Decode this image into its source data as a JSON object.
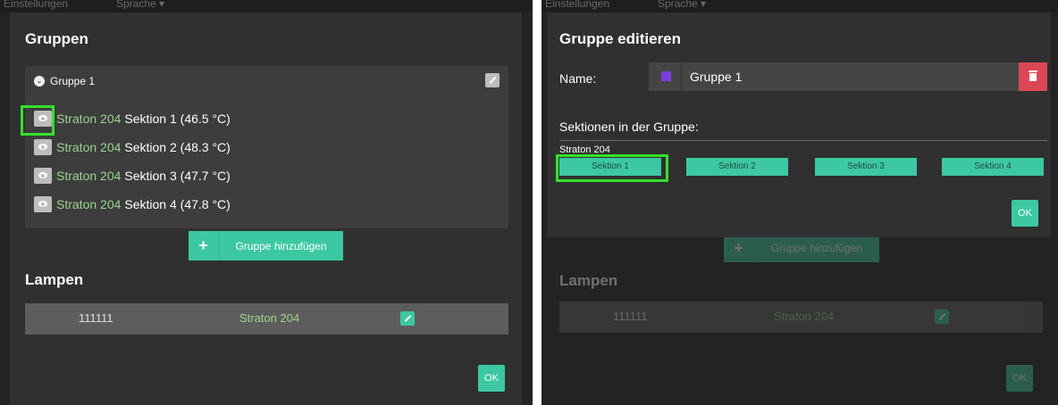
{
  "menubar": {
    "items": [
      "Einstellungen",
      "Sprache ▾"
    ]
  },
  "groups_modal": {
    "title": "Gruppen",
    "group": {
      "name": "Gruppe 1",
      "sections": [
        {
          "lamp": "Straton 204",
          "label": "Sektion 1 (46.5 °C)"
        },
        {
          "lamp": "Straton 204",
          "label": "Sektion 2 (48.3 °C)"
        },
        {
          "lamp": "Straton 204",
          "label": "Sektion 3 (47.7 °C)"
        },
        {
          "lamp": "Straton 204",
          "label": "Sektion 4 (47.8 °C)"
        }
      ]
    },
    "add_group": {
      "plus": "+",
      "label": "Gruppe hinzufügen"
    },
    "lamps_title": "Lampen",
    "lamp": {
      "id": "111111",
      "location": "Straton 204"
    },
    "ok_label": "OK"
  },
  "edit_dialog": {
    "title": "Gruppe editieren",
    "name_label": "Name:",
    "name_value": "Gruppe 1",
    "swatch_color": "#7a3ee0",
    "sections_label": "Sektionen in der Gruppe:",
    "lamp_group": "Straton 204",
    "sections": [
      "Sektion 1",
      "Sektion 2",
      "Sektion 3",
      "Sektion 4"
    ],
    "ok_label": "OK"
  },
  "colors": {
    "accent": "#3cc8a2",
    "danger": "#dc4655",
    "highlight": "#33e12c",
    "lamp_text": "#9bd38f"
  }
}
